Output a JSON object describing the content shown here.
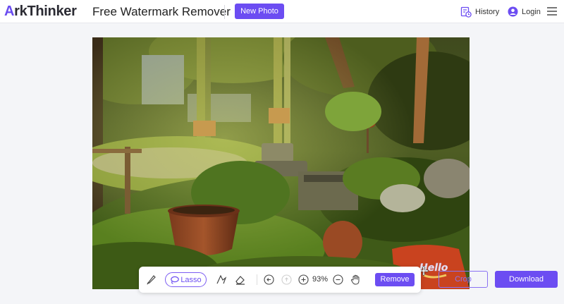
{
  "header": {
    "logo_a": "A",
    "logo_rest": "rkThinker",
    "title": "Free Watermark Remover",
    "new_photo": "New Photo",
    "history": "History",
    "login": "Login"
  },
  "toolbar": {
    "lasso": "Lasso",
    "zoom": "93%",
    "remove": "Remove"
  },
  "actions": {
    "crop": "Crop",
    "download": "Download"
  },
  "watermark": {
    "text": "Hello"
  },
  "colors": {
    "accent": "#6c4df2",
    "background": "#f4f5f8"
  },
  "icons": [
    "history-icon",
    "user-icon",
    "menu-icon",
    "brush-icon",
    "lasso-icon",
    "polygon-icon",
    "eraser-icon",
    "undo-icon",
    "redo-icon",
    "zoom-in-icon",
    "zoom-out-icon",
    "hand-icon",
    "move-icon"
  ]
}
